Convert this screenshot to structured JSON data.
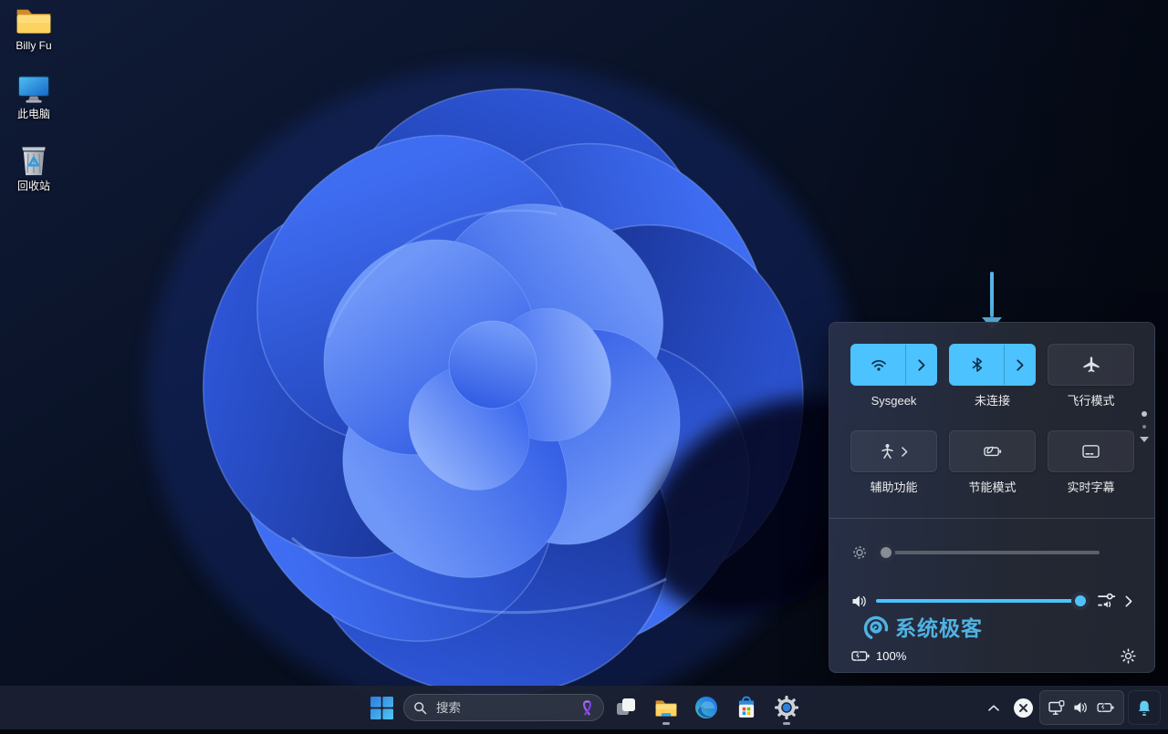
{
  "desktop": {
    "icons": [
      {
        "label": "Billy Fu",
        "icon": "folder-icon"
      },
      {
        "label": "此电脑",
        "icon": "this-pc-icon"
      },
      {
        "label": "回收站",
        "icon": "recycle-bin-icon"
      }
    ]
  },
  "annotation": {
    "pointer_target": "bluetooth-tile",
    "arrow_color": "#58b5e6"
  },
  "quick_settings": {
    "accent_color": "#4cc2ff",
    "tiles": [
      {
        "label": "Sysgeek",
        "icon": "wifi-icon",
        "state": "on"
      },
      {
        "label": "未连接",
        "icon": "bluetooth-icon",
        "state": "on"
      },
      {
        "label": "飞行模式",
        "icon": "airplane-icon",
        "state": "off"
      },
      {
        "label": "辅助功能",
        "icon": "accessibility-icon",
        "state": "off"
      },
      {
        "label": "节能模式",
        "icon": "energy-saver-icon",
        "state": "off"
      },
      {
        "label": "实时字幕",
        "icon": "live-captions-icon",
        "state": "off"
      }
    ],
    "brightness_percent": 4,
    "volume_percent": 96,
    "battery_status": "100%",
    "watermark_text": "系统极客",
    "pager_dots": 2
  },
  "taskbar": {
    "search_placeholder": "搜索",
    "apps": [
      {
        "name": "task-view",
        "running": false
      },
      {
        "name": "file-explorer",
        "running": true
      },
      {
        "name": "edge",
        "running": false
      },
      {
        "name": "microsoft-store",
        "running": false
      },
      {
        "name": "settings",
        "running": true
      }
    ],
    "tray_icons": [
      "hidden-icons-chevron",
      "shield-x-icon",
      "network-display-icon",
      "volume-icon",
      "battery-icon",
      "notification-bell-icon"
    ]
  }
}
